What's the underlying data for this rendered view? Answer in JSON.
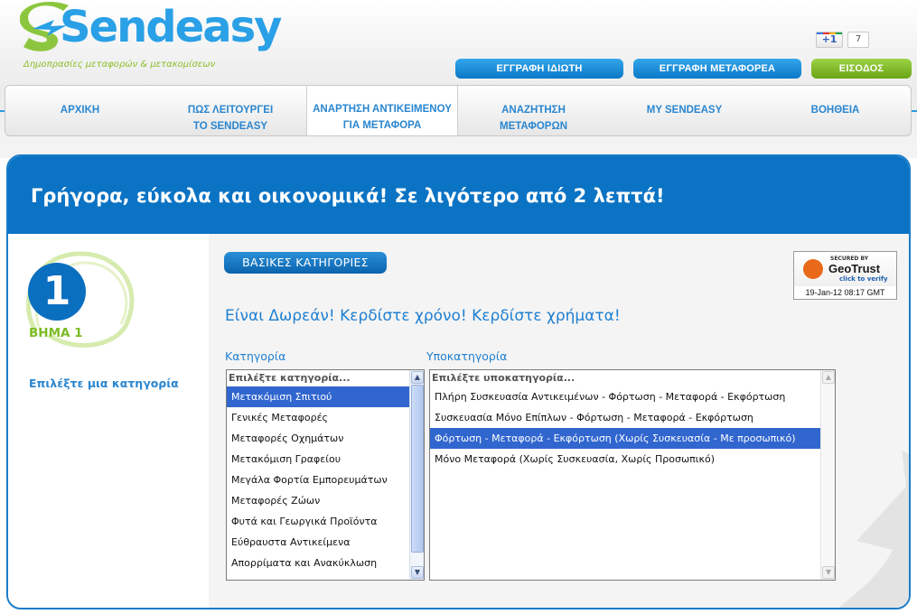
{
  "brand": {
    "name": "Sendeasy",
    "tagline": "Δημοπρασίες μεταφορών & μετακομίσεων"
  },
  "social": {
    "gplus_label": "+1",
    "gplus_count": "7"
  },
  "top_buttons": {
    "register_private": "ΕΓΓΡΑΦΗ ΙΔΙΩΤΗ",
    "register_carrier": "ΕΓΓΡΑΦΗ ΜΕΤΑΦΟΡΕΑ",
    "login": "ΕΙΣΟΔΟΣ"
  },
  "nav": {
    "items": [
      {
        "line1": "ΑΡΧΙΚΗ",
        "line2": ""
      },
      {
        "line1": "ΠΩΣ ΛΕΙΤΟΥΡΓΕΙ",
        "line2": "ΤΟ SENDEASY"
      },
      {
        "line1": "ΑΝΑΡΤΗΣΗ ΑΝΤΙΚΕΙΜΕΝΟΥ",
        "line2": "ΓΙΑ ΜΕΤΑΦΟΡΑ"
      },
      {
        "line1": "ΑΝΑΖΗΤΗΣΗ",
        "line2": "ΜΕΤΑΦΟΡΩΝ"
      },
      {
        "line1": "MY SENDEASY",
        "line2": ""
      },
      {
        "line1": "ΒΟΗΘΕΙΑ",
        "line2": ""
      }
    ],
    "active_index": 2
  },
  "banner": {
    "text": "Γρήγορα, εύκολα και οικονομικά! Σε λιγότερο από 2 λεπτά!"
  },
  "step": {
    "number": "1",
    "label": "ΒΗΜΑ 1",
    "hint": "Επιλέξτε μια κατηγορία"
  },
  "content": {
    "section_button": "ΒΑΣΙΚΕΣ ΚΑΤΗΓΟΡΙΕΣ",
    "slogan": "Είναι Δωρεάν! Κερδίστε χρόνο! Κερδίστε χρήματα!",
    "category_label": "Κατηγορία",
    "subcategory_label": "Υποκατηγορία"
  },
  "geotrust": {
    "secured_by": "SECURED BY",
    "name": "GeoTrust",
    "verify": "click to verify",
    "date": "19-Jan-12 08:17 GMT"
  },
  "categories": {
    "placeholder": "Επιλέξτε κατηγορία...",
    "items": [
      "Μετακόμιση Σπιτιού",
      "Γενικές Μεταφορές",
      "Μεταφορές Οχημάτων",
      "Μετακόμιση Γραφείου",
      "Μεγάλα Φορτία Εμπορευμάτων",
      "Μεταφορές Ζώων",
      "Φυτά και Γεωργικά Προϊόντα",
      "Εύθραυστα Αντικείμενα",
      "Απορρίματα και Ανακύκλωση",
      "..."
    ],
    "selected_index": 0
  },
  "subcategories": {
    "placeholder": "Επιλέξτε υποκατηγορία...",
    "items": [
      "Πλήρη Συσκευασία Αντικειμένων - Φόρτωση - Μεταφορά - Εκφόρτωση",
      "Συσκευασία Μόνο Επίπλων - Φόρτωση - Μεταφορά - Εκφόρτωση",
      "Φόρτωση - Μεταφορά - Εκφόρτωση (Χωρίς Συσκευασία - Με προσωπικό)",
      "Μόνο Μεταφορά (Χωρίς Συσκευασία, Χωρίς Προσωπικό)"
    ],
    "selected_index": 2
  },
  "colors": {
    "primary_blue": "#0b73c4",
    "link_blue": "#1f7fd0",
    "accent_green": "#7cbc25",
    "selection_blue": "#3166cf"
  }
}
